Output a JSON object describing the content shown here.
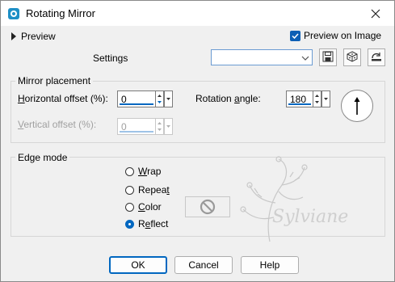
{
  "window": {
    "title": "Rotating Mirror",
    "close_icon": "close-icon",
    "app_icon": "app-icon"
  },
  "top": {
    "preview_label": "Preview",
    "preview_on_image_label": "Preview on Image",
    "preview_on_image_checked": true,
    "settings_label": "Settings",
    "settings_value": ""
  },
  "mirror": {
    "group_title": "Mirror placement",
    "horizontal_label": "Horizontal offset (%):",
    "horizontal_value": "0",
    "vertical_label": "Vertical offset (%):",
    "vertical_value": "0",
    "rotation_label": "Rotation angle:",
    "rotation_value": "180"
  },
  "edge": {
    "group_title": "Edge mode",
    "options": [
      {
        "label": "Wrap",
        "checked": false
      },
      {
        "label": "Repeat",
        "checked": false
      },
      {
        "label": "Color",
        "checked": false
      },
      {
        "label": "Reflect",
        "checked": true
      }
    ]
  },
  "watermark_text": "Sylviane",
  "buttons": {
    "ok": "OK",
    "cancel": "Cancel",
    "help": "Help"
  },
  "colors": {
    "accent": "#0067c0",
    "window_bg": "#f0f0f0",
    "titlebar_bg": "#ffffff"
  }
}
